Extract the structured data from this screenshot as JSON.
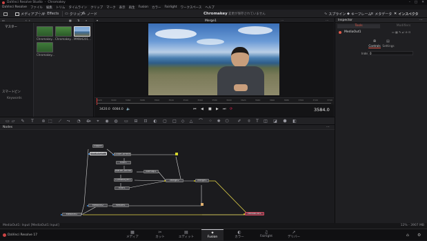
{
  "window": {
    "app": "DaVinci Resolve Studio",
    "project": "Chromakey"
  },
  "menu": [
    "DaVinci Resolve",
    "ファイル",
    "編集",
    "トリム",
    "タイムライン",
    "クリップ",
    "マーク",
    "表示",
    "再生",
    "Fusion",
    "カラー",
    "Fairlight",
    "ワークスペース",
    "ヘルプ"
  ],
  "toolbar": {
    "media_pool": "メディアプール",
    "effects": "Effects",
    "clips": "クリップ",
    "nodes": "ノード",
    "project_title": "Chromakey",
    "unsaved": "変更が保存されていません",
    "spline": "スプライン",
    "keyframes": "キーフレーム",
    "metadata": "メタデータ",
    "inspector": "インスペクタ"
  },
  "media_pool": {
    "master": "マスター",
    "smart_bins": "スマートビン",
    "keywords": "Keywords",
    "clips": [
      {
        "name": "Chromakey..."
      },
      {
        "name": "Chromakey..."
      },
      {
        "name": "MMW4201..."
      },
      {
        "name": "Chromakey..."
      }
    ]
  },
  "viewer": {
    "title": "Merge1",
    "start_frame": "3420.0",
    "end_frame": "6084.0",
    "current_time": "3584.0",
    "ruler": [
      "3420",
      "3440",
      "3460",
      "3480",
      "3500",
      "3520",
      "3540",
      "3560",
      "3580",
      "3600",
      "3620",
      "3640",
      "3660",
      "3680",
      "3700",
      "3720",
      "3740"
    ]
  },
  "inspector": {
    "title": "Inspector",
    "tabs": [
      "Tools",
      "Modifiers"
    ],
    "tool": "MediaOut1",
    "subtabs": [
      "Controls",
      "Settings"
    ],
    "index_label": "Index",
    "index_value": "0"
  },
  "nodes_panel": {
    "title": "Nodes",
    "nodes": [
      {
        "id": "clipper",
        "label": "clipper"
      },
      {
        "id": "deltakeyer1",
        "label": "DeltaKeyer1"
      },
      {
        "id": "colorcorrector1",
        "label": "ColorCorrector1"
      },
      {
        "id": "blur1",
        "label": "Blur1"
      },
      {
        "id": "mattecontrol1",
        "label": "MatteControl1"
      },
      {
        "id": "bitmap1",
        "label": "Bitmap1"
      },
      {
        "id": "lumakeyer1",
        "label": "LumaKeyer1"
      },
      {
        "id": "blur2",
        "label": "Blur1"
      },
      {
        "id": "merge2",
        "label": "Merge2"
      },
      {
        "id": "merge1",
        "label": "Merge1"
      },
      {
        "id": "mediain2",
        "label": "MediaIn2"
      },
      {
        "id": "resize1",
        "label": "Resize1"
      },
      {
        "id": "mediain1",
        "label": "MediaIn1"
      },
      {
        "id": "mediaout1",
        "label": "MediaOut1"
      }
    ]
  },
  "status": {
    "left": "MediaOut1: Input [MediaOut1 Input]",
    "right": "12% - 3907 MB"
  },
  "pages": [
    {
      "label": "メディア",
      "icon": "▦"
    },
    {
      "label": "カット",
      "icon": "✂"
    },
    {
      "label": "エディット",
      "icon": "▤"
    },
    {
      "label": "Fusion",
      "icon": "✦"
    },
    {
      "label": "カラー",
      "icon": "◐"
    },
    {
      "label": "Fairlight",
      "icon": "♫"
    },
    {
      "label": "デリバー",
      "icon": "➚"
    }
  ],
  "app_footer": "DaVinci Resolve 17"
}
